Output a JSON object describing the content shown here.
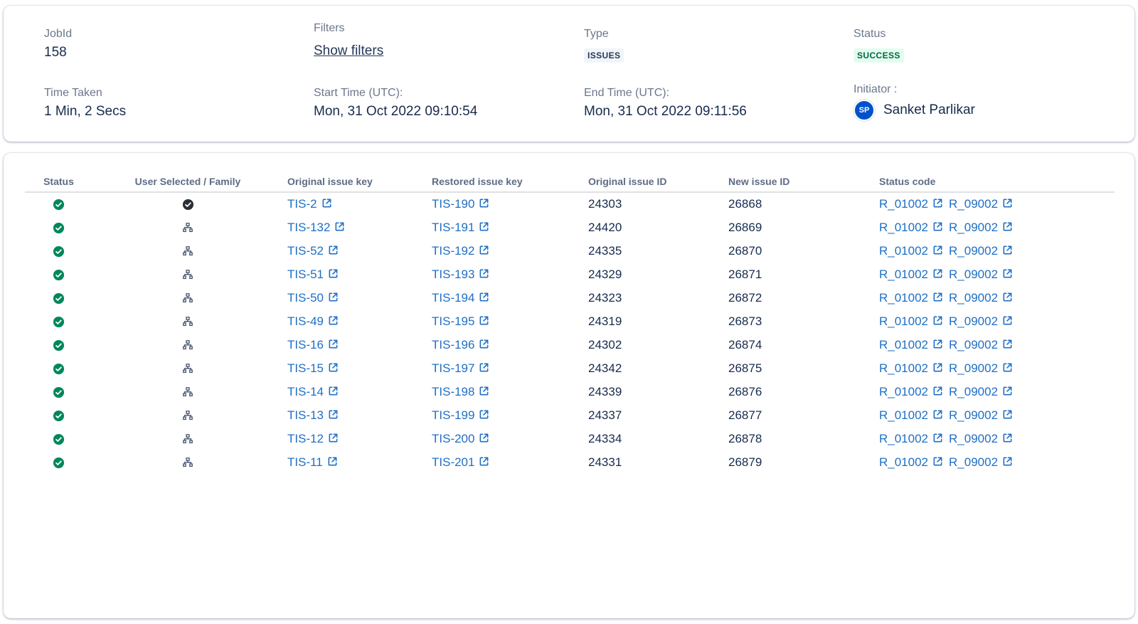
{
  "summary": {
    "jobid_label": "JobId",
    "jobid_value": "158",
    "filters_label": "Filters",
    "filters_link": "Show filters",
    "type_label": "Type",
    "type_value": "ISSUES",
    "status_label": "Status",
    "status_value": "SUCCESS",
    "time_taken_label": "Time Taken",
    "time_taken_value": "1 Min, 2 Secs",
    "start_label": "Start Time (UTC):",
    "start_value": "Mon, 31 Oct 2022 09:10:54",
    "end_label": "End Time (UTC):",
    "end_value": "Mon, 31 Oct 2022 09:11:56",
    "initiator_label": "Initiator :",
    "initiator_initials": "SP",
    "initiator_name": "Sanket Parlikar"
  },
  "colors": {
    "success_green": "#00875a",
    "link_blue": "#1f6fc5",
    "avatar_blue": "#0052cc"
  },
  "table": {
    "headers": [
      "Status",
      "User Selected / Family",
      "Original issue key",
      "Restored issue key",
      "Original issue ID",
      "New issue ID",
      "Status code"
    ],
    "rows": [
      {
        "status_icon": "check-circle-icon",
        "selection": "user-selected",
        "orig_key": "TIS-2",
        "rest_key": "TIS-190",
        "orig_id": "24303",
        "new_id": "26868",
        "codes": [
          "R_01002",
          "R_09002"
        ]
      },
      {
        "status_icon": "check-circle-icon",
        "selection": "family",
        "orig_key": "TIS-132",
        "rest_key": "TIS-191",
        "orig_id": "24420",
        "new_id": "26869",
        "codes": [
          "R_01002",
          "R_09002"
        ]
      },
      {
        "status_icon": "check-circle-icon",
        "selection": "family",
        "orig_key": "TIS-52",
        "rest_key": "TIS-192",
        "orig_id": "24335",
        "new_id": "26870",
        "codes": [
          "R_01002",
          "R_09002"
        ]
      },
      {
        "status_icon": "check-circle-icon",
        "selection": "family",
        "orig_key": "TIS-51",
        "rest_key": "TIS-193",
        "orig_id": "24329",
        "new_id": "26871",
        "codes": [
          "R_01002",
          "R_09002"
        ]
      },
      {
        "status_icon": "check-circle-icon",
        "selection": "family",
        "orig_key": "TIS-50",
        "rest_key": "TIS-194",
        "orig_id": "24323",
        "new_id": "26872",
        "codes": [
          "R_01002",
          "R_09002"
        ]
      },
      {
        "status_icon": "check-circle-icon",
        "selection": "family",
        "orig_key": "TIS-49",
        "rest_key": "TIS-195",
        "orig_id": "24319",
        "new_id": "26873",
        "codes": [
          "R_01002",
          "R_09002"
        ]
      },
      {
        "status_icon": "check-circle-icon",
        "selection": "family",
        "orig_key": "TIS-16",
        "rest_key": "TIS-196",
        "orig_id": "24302",
        "new_id": "26874",
        "codes": [
          "R_01002",
          "R_09002"
        ]
      },
      {
        "status_icon": "check-circle-icon",
        "selection": "family",
        "orig_key": "TIS-15",
        "rest_key": "TIS-197",
        "orig_id": "24342",
        "new_id": "26875",
        "codes": [
          "R_01002",
          "R_09002"
        ]
      },
      {
        "status_icon": "check-circle-icon",
        "selection": "family",
        "orig_key": "TIS-14",
        "rest_key": "TIS-198",
        "orig_id": "24339",
        "new_id": "26876",
        "codes": [
          "R_01002",
          "R_09002"
        ]
      },
      {
        "status_icon": "check-circle-icon",
        "selection": "family",
        "orig_key": "TIS-13",
        "rest_key": "TIS-199",
        "orig_id": "24337",
        "new_id": "26877",
        "codes": [
          "R_01002",
          "R_09002"
        ]
      },
      {
        "status_icon": "check-circle-icon",
        "selection": "family",
        "orig_key": "TIS-12",
        "rest_key": "TIS-200",
        "orig_id": "24334",
        "new_id": "26878",
        "codes": [
          "R_01002",
          "R_09002"
        ]
      },
      {
        "status_icon": "check-circle-icon",
        "selection": "family",
        "orig_key": "TIS-11",
        "rest_key": "TIS-201",
        "orig_id": "24331",
        "new_id": "26879",
        "codes": [
          "R_01002",
          "R_09002"
        ]
      }
    ]
  }
}
